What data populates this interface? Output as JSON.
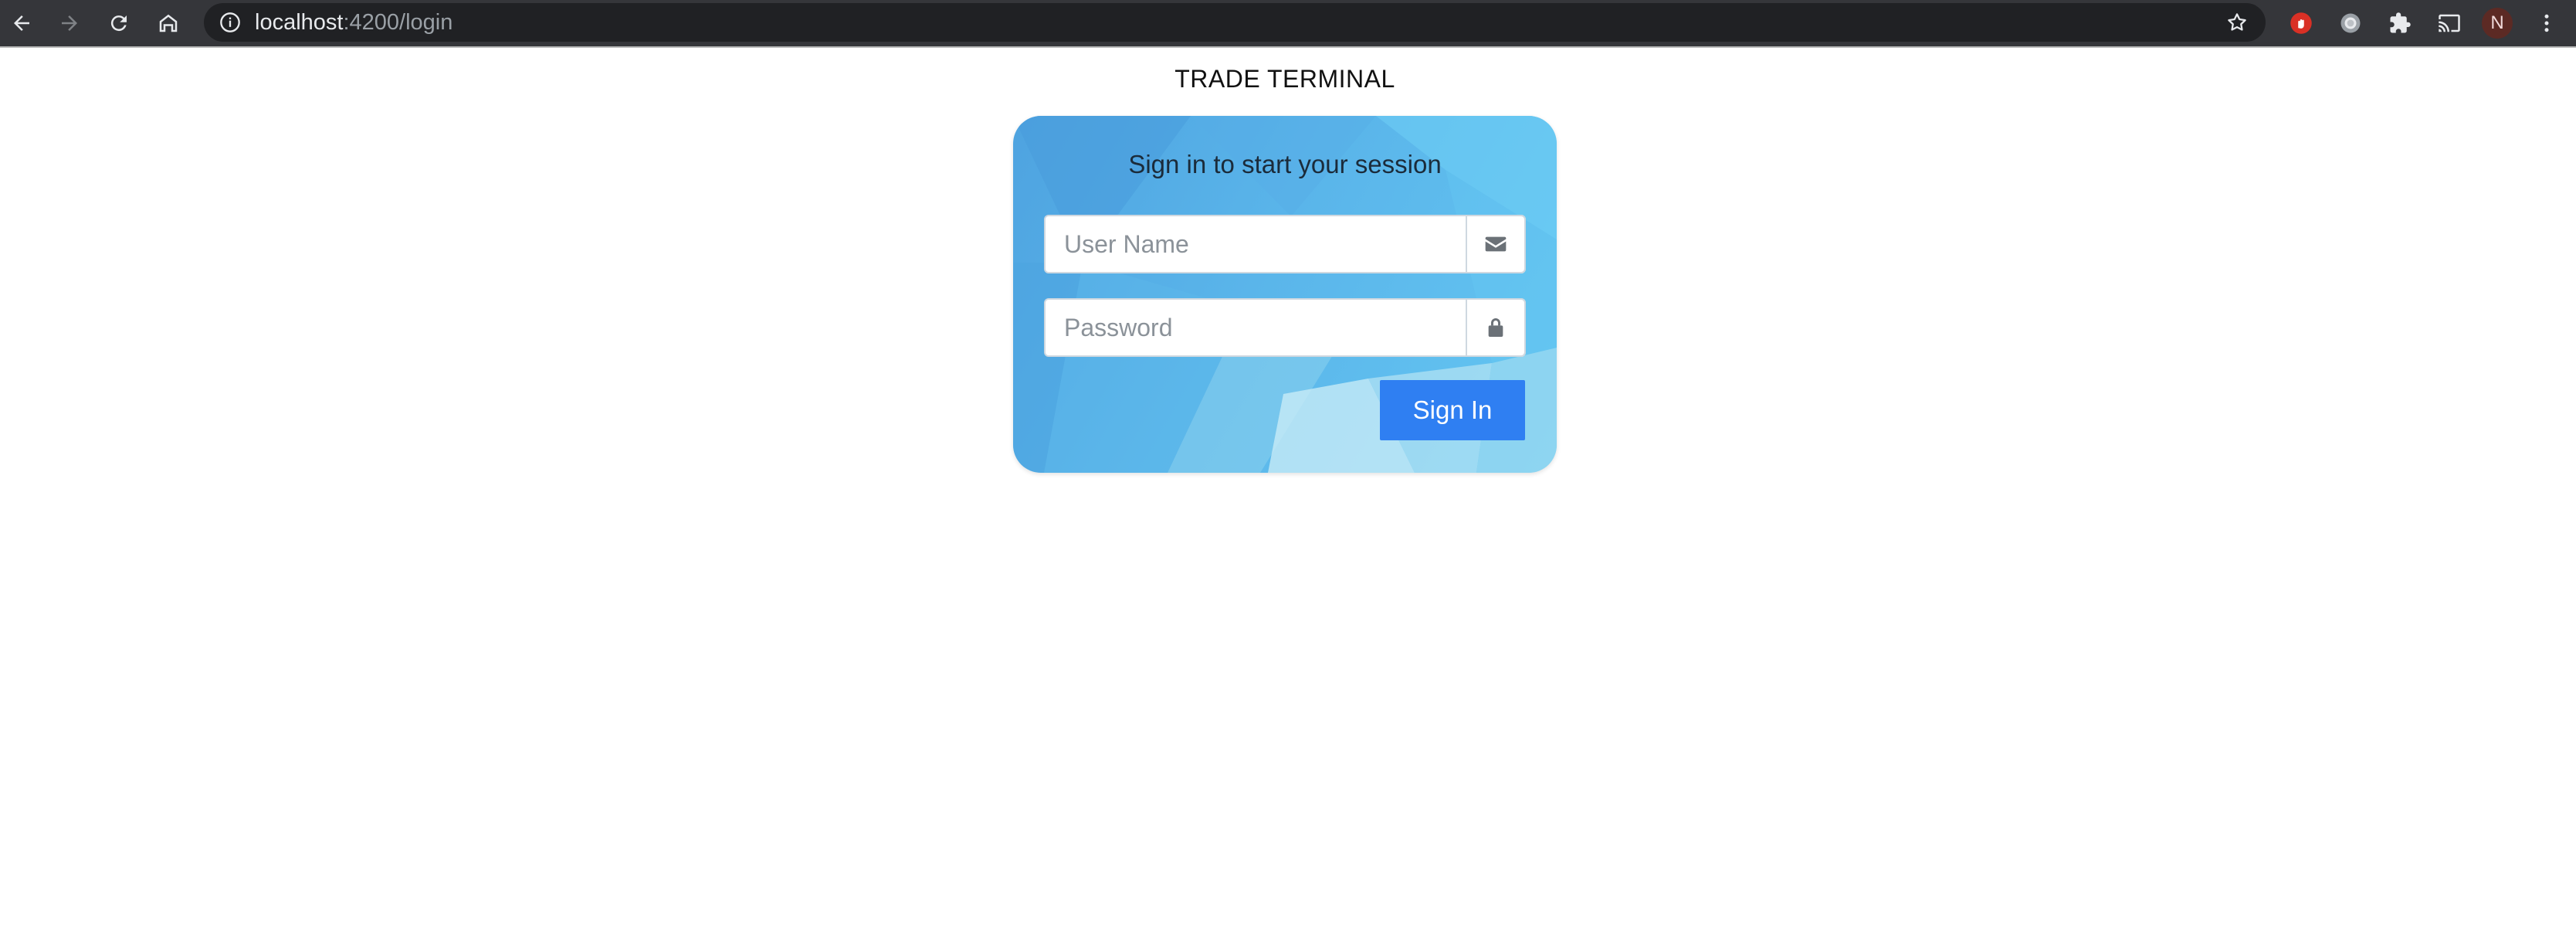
{
  "browser": {
    "url_host": "localhost",
    "url_rest": ":4200/login",
    "profile_initial": "N",
    "icons": [
      "back-arrow-icon",
      "forward-arrow-icon",
      "reload-icon",
      "home-icon",
      "info-icon",
      "star-icon",
      "hand-extension-icon",
      "circle-extension-icon",
      "puzzle-extensions-icon",
      "cast-icon",
      "kebab-menu-icon"
    ]
  },
  "page": {
    "title": "TRADE TERMINAL"
  },
  "login": {
    "heading": "Sign in to start your session",
    "username_placeholder": "User Name",
    "username_value": "",
    "password_placeholder": "Password",
    "password_value": "",
    "signin_label": "Sign In",
    "username_icon": "envelope-icon",
    "password_icon": "lock-icon"
  },
  "colors": {
    "card_gradient_start": "#4ea3e0",
    "card_gradient_end": "#64c6f2",
    "button": "#2f7ff2",
    "chrome": "#35363a"
  }
}
